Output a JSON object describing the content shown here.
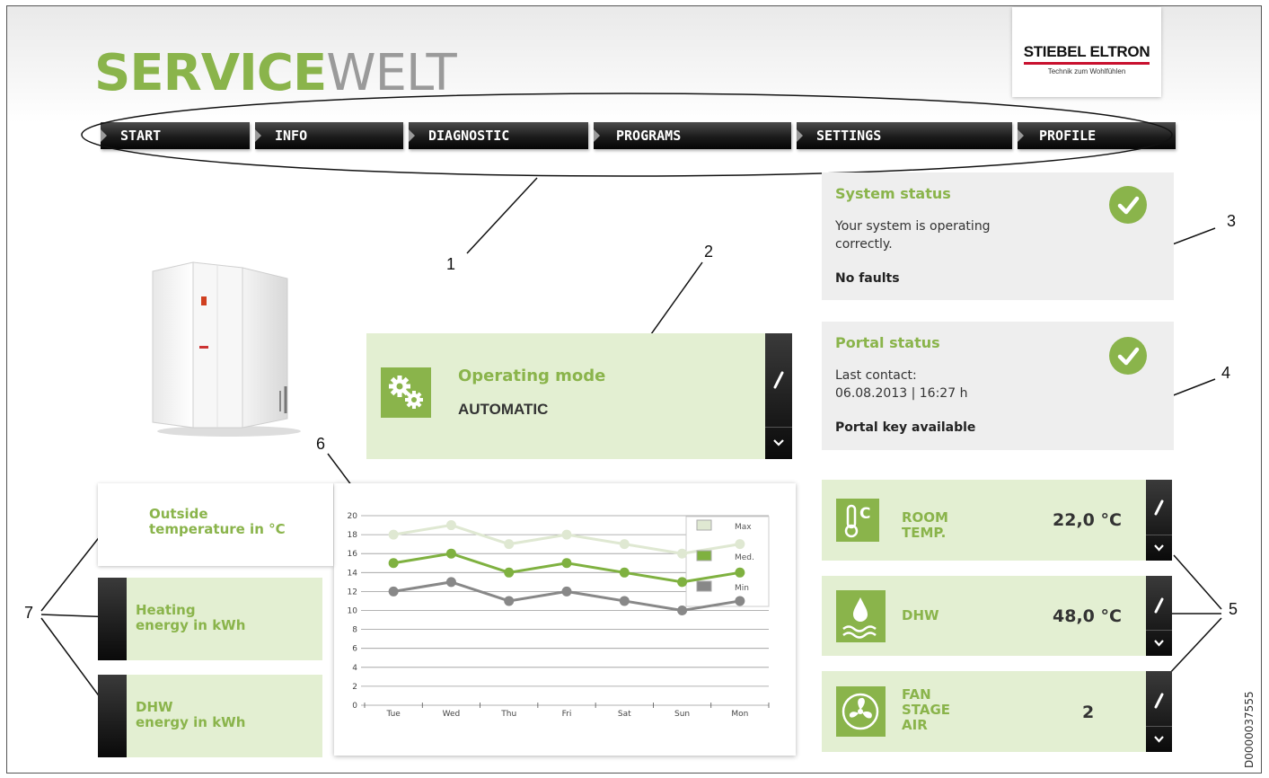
{
  "logo": {
    "part1": "SERVICE",
    "part2": "WELT"
  },
  "brand": {
    "name": "STIEBEL ELTRON",
    "slogan": "Technik zum Wohlfühlen"
  },
  "nav": [
    "START",
    "INFO",
    "DIAGNOSTIC",
    "PROGRAMS",
    "SETTINGS",
    "PROFILE"
  ],
  "system_status": {
    "title": "System status",
    "text": "Your system is operating correctly.",
    "bold": "No faults"
  },
  "portal_status": {
    "title": "Portal status",
    "line1": "Last contact:",
    "line2": "06.08.2013 | 16:27 h",
    "bold": "Portal key available"
  },
  "operating_mode": {
    "label": "Operating mode",
    "value": "AUTOMATIC"
  },
  "tiles": [
    {
      "label1": "ROOM",
      "label2": "TEMP.",
      "value": "22,0 °C",
      "icon": "thermometer-celsius-icon"
    },
    {
      "label1": "DHW",
      "value": "48,0 °C",
      "icon": "water-drop-icon"
    },
    {
      "label1": "FAN",
      "label2": "STAGE",
      "label3": "AIR",
      "value": "2",
      "icon": "fan-icon"
    }
  ],
  "categories": [
    {
      "line1": "Outside",
      "line2": "temperature in °C"
    },
    {
      "line1": "Heating",
      "line2": "energy in kWh"
    },
    {
      "line1": "DHW",
      "line2": "energy in kWh"
    }
  ],
  "callouts": [
    "1",
    "2",
    "3",
    "4",
    "5",
    "6",
    "7"
  ],
  "doc_id": "D0000037555",
  "chart_data": {
    "type": "line",
    "categories": [
      "Tue",
      "Wed",
      "Thu",
      "Fri",
      "Sat",
      "Sun",
      "Mon"
    ],
    "series": [
      {
        "name": "Max",
        "values": [
          18,
          19,
          17,
          18,
          17,
          16,
          17
        ],
        "color": "#dfe8d2"
      },
      {
        "name": "Med.",
        "values": [
          15,
          16,
          14,
          15,
          14,
          13,
          14
        ],
        "color": "#7fb140"
      },
      {
        "name": "Min",
        "values": [
          12,
          13,
          11,
          12,
          11,
          10,
          11
        ],
        "color": "#888888"
      }
    ],
    "yticks": [
      "0",
      "2",
      "4",
      "6",
      "8",
      "10",
      "12",
      "14",
      "16",
      "18",
      "20"
    ],
    "ylim": [
      0,
      20
    ],
    "grid": true,
    "legend": "top-right"
  }
}
